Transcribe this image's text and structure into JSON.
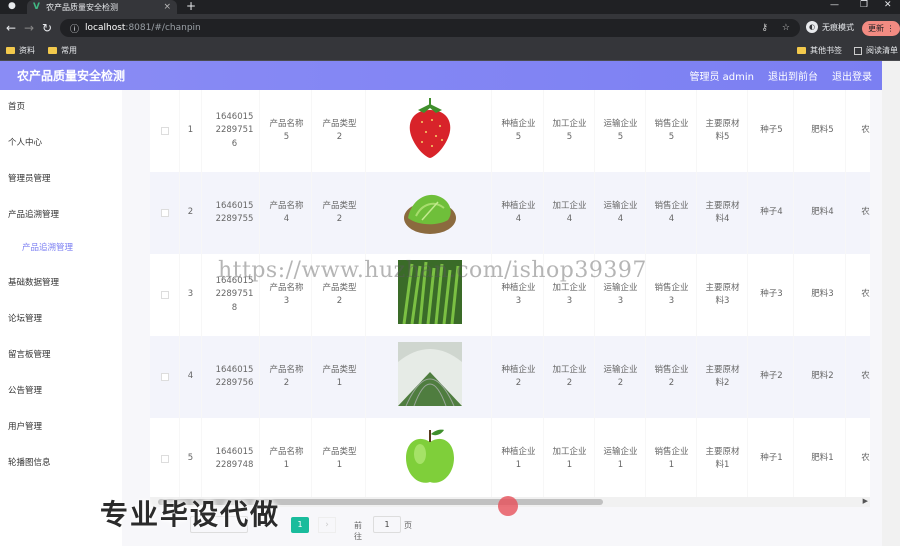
{
  "browser": {
    "tab_title": "农产品质量安全检测",
    "url_host": "localhost",
    "url_path": ":8081/#/chanpin",
    "incognito_label": "无痕模式",
    "update_label": "更新",
    "bookmarks": [
      "资料",
      "常用"
    ],
    "bookmarks_right": [
      "其他书签",
      "阅读清单"
    ]
  },
  "header": {
    "title": "农产品质量安全检测",
    "user_label": "管理员 admin",
    "back_label": "退出到前台",
    "logout_label": "退出登录"
  },
  "sidebar": {
    "items": [
      {
        "label": "首页"
      },
      {
        "label": "个人中心"
      },
      {
        "label": "管理员管理"
      },
      {
        "label": "产品追溯管理"
      },
      {
        "label": "产品追溯管理"
      },
      {
        "label": "基础数据管理"
      },
      {
        "label": "论坛管理"
      },
      {
        "label": "留言板管理"
      },
      {
        "label": "公告管理"
      },
      {
        "label": "用户管理"
      },
      {
        "label": "轮播图信息"
      }
    ]
  },
  "table": {
    "rows": [
      {
        "index": "1",
        "code": "1646015 2289751 6",
        "name": "产品名称 5",
        "type": "产品类型 2",
        "image": "strawberry",
        "plant": "种植企业 5",
        "process": "加工企业 5",
        "transport": "运输企业 5",
        "sales": "销售企业 5",
        "material": "主要原材 料5",
        "seed": "种子5",
        "fertilizer": "肥料5",
        "extra": "农"
      },
      {
        "index": "2",
        "code": "1646015 2289755",
        "name": "产品名称 4",
        "type": "产品类型 2",
        "image": "lettuce",
        "plant": "种植企业 4",
        "process": "加工企业 4",
        "transport": "运输企业 4",
        "sales": "销售企业 4",
        "material": "主要原材 料4",
        "seed": "种子4",
        "fertilizer": "肥料4",
        "extra": "农"
      },
      {
        "index": "3",
        "code": "1646015 2289751 8",
        "name": "产品名称 3",
        "type": "产品类型 2",
        "image": "green-onion",
        "plant": "种植企业 3",
        "process": "加工企业 3",
        "transport": "运输企业 3",
        "sales": "销售企业 3",
        "material": "主要原材 料3",
        "seed": "种子3",
        "fertilizer": "肥料3",
        "extra": "农"
      },
      {
        "index": "4",
        "code": "1646015 2289756",
        "name": "产品名称 2",
        "type": "产品类型 1",
        "image": "greenhouse",
        "plant": "种植企业 2",
        "process": "加工企业 2",
        "transport": "运输企业 2",
        "sales": "销售企业 2",
        "material": "主要原材 料2",
        "seed": "种子2",
        "fertilizer": "肥料2",
        "extra": "农"
      },
      {
        "index": "5",
        "code": "1646015 2289748",
        "name": "产品名称 1",
        "type": "产品类型 1",
        "image": "green-apple",
        "plant": "种植企业 1",
        "process": "加工企业 1",
        "transport": "运输企业 1",
        "sales": "销售企业 1",
        "material": "主要原材 料1",
        "seed": "种子1",
        "fertilizer": "肥料1",
        "extra": "农"
      }
    ]
  },
  "pagination": {
    "current_page": "1",
    "prev": "‹",
    "next": "›",
    "goto_label": "前往",
    "goto_value": "1",
    "unit_label": "页"
  },
  "overlay": {
    "watermark": "https://www.huzhan.com/ishop39397",
    "caption": "专业毕设代做"
  },
  "colors": {
    "header_bg": "#7b7ff2",
    "active_menu": "#7b7ff2",
    "page_active": "#1abc9c"
  }
}
